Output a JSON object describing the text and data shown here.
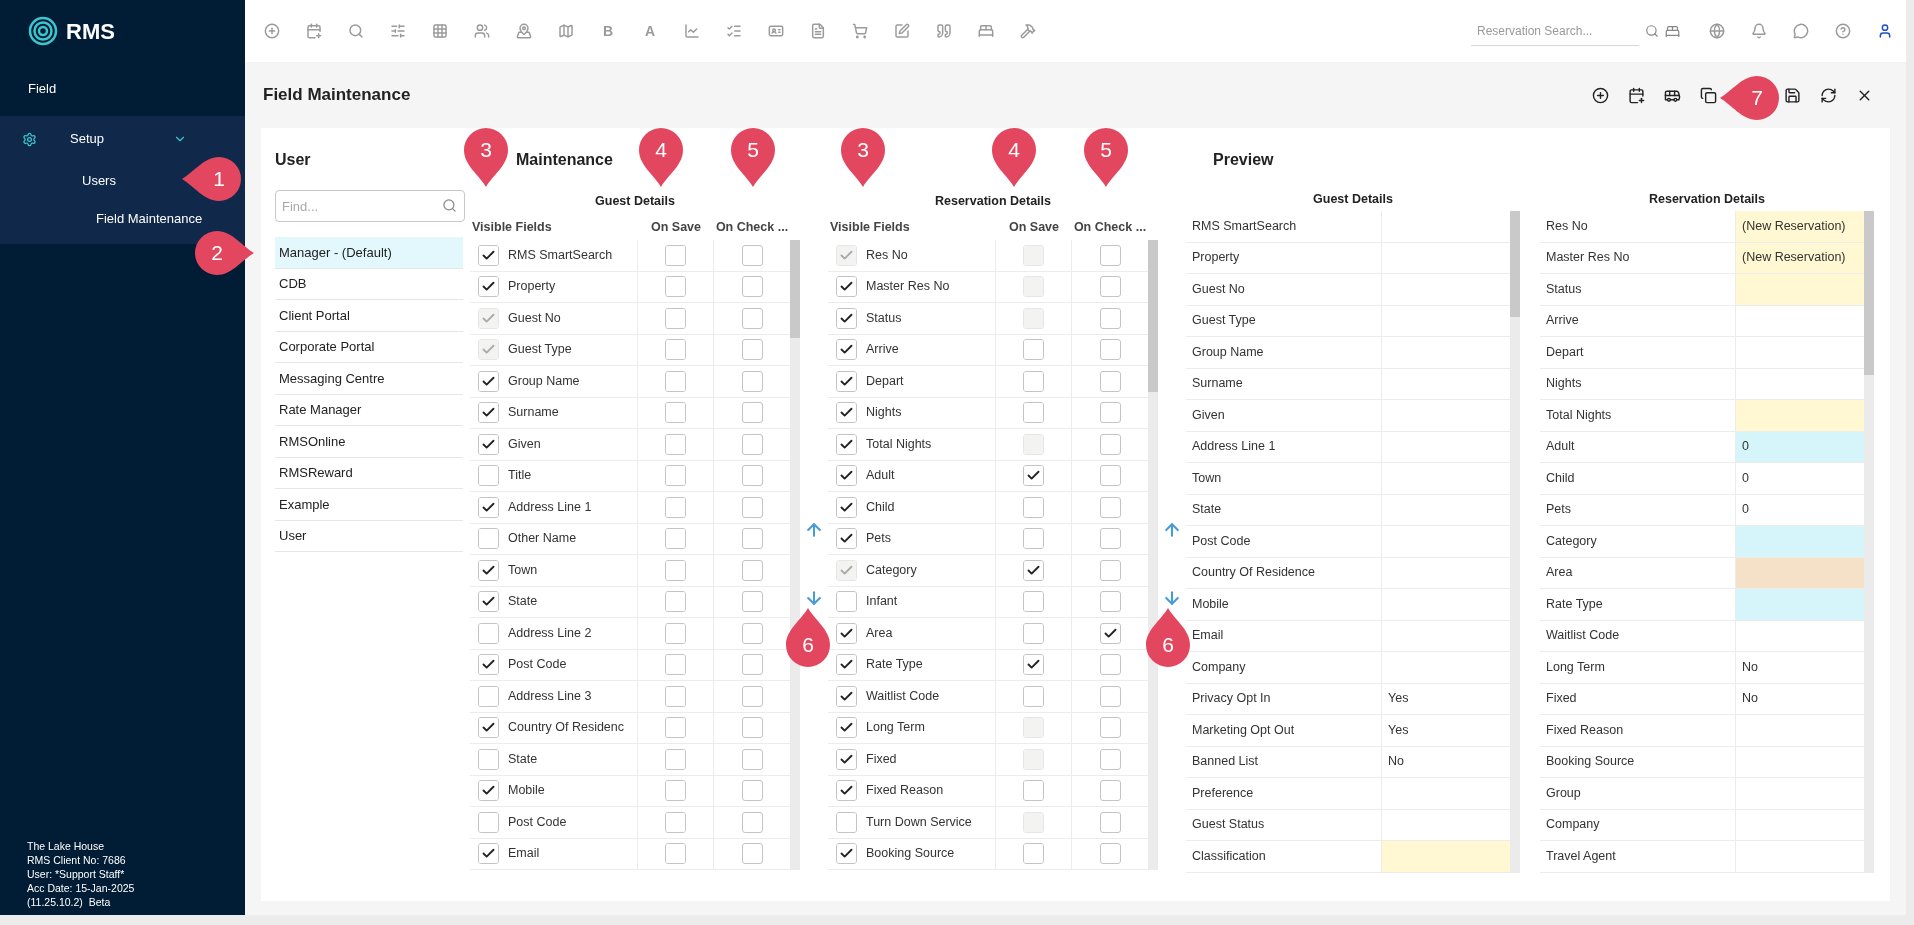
{
  "sidebar": {
    "logo": "RMS",
    "search": {
      "value": "Field"
    },
    "menu": [
      {
        "label": "Setup",
        "expanded": true,
        "children": [
          {
            "label": "Users"
          },
          {
            "label": "Field Maintenance"
          }
        ]
      }
    ],
    "footer": [
      "The Lake House",
      "RMS Client No: 7686",
      "User: *Support Staff*",
      "Acc Date: 15-Jan-2025",
      "(11.25.10.2)  Beta"
    ]
  },
  "topbar": {
    "letters": [
      "B",
      "A"
    ],
    "search": {
      "placeholder": "Reservation Search..."
    }
  },
  "page": {
    "title": "Field Maintenance"
  },
  "users": {
    "title": "User",
    "search": {
      "placeholder": "Find..."
    },
    "items": [
      {
        "label": "Manager - (Default)",
        "selected": true
      },
      {
        "label": "CDB",
        "selected": false
      },
      {
        "label": "Client Portal",
        "selected": false
      },
      {
        "label": "Corporate Portal",
        "selected": false
      },
      {
        "label": "Messaging Centre",
        "selected": false
      },
      {
        "label": "Rate Manager",
        "selected": false
      },
      {
        "label": "RMSOnline",
        "selected": false
      },
      {
        "label": "RMSReward",
        "selected": false
      },
      {
        "label": "Example",
        "selected": false
      },
      {
        "label": "User",
        "selected": false
      }
    ]
  },
  "maintenance": {
    "title": "Maintenance",
    "tables": [
      {
        "title": "Guest Details",
        "columns": [
          "Visible Fields",
          "On Save",
          "On Check ..."
        ],
        "rows": [
          {
            "field": "RMS SmartSearch",
            "visible": true,
            "locked": false,
            "on_save": false,
            "save_locked": false,
            "on_check": false
          },
          {
            "field": "Property",
            "visible": true,
            "locked": false,
            "on_save": false,
            "save_locked": false,
            "on_check": false
          },
          {
            "field": "Guest No",
            "visible": true,
            "locked": true,
            "on_save": false,
            "save_locked": false,
            "on_check": false
          },
          {
            "field": "Guest Type",
            "visible": true,
            "locked": true,
            "on_save": false,
            "save_locked": false,
            "on_check": false
          },
          {
            "field": "Group Name",
            "visible": true,
            "locked": false,
            "on_save": false,
            "save_locked": false,
            "on_check": false
          },
          {
            "field": "Surname",
            "visible": true,
            "locked": false,
            "on_save": false,
            "save_locked": false,
            "on_check": false
          },
          {
            "field": "Given",
            "visible": true,
            "locked": false,
            "on_save": false,
            "save_locked": false,
            "on_check": false
          },
          {
            "field": "Title",
            "visible": false,
            "locked": false,
            "on_save": false,
            "save_locked": false,
            "on_check": false
          },
          {
            "field": "Address Line 1",
            "visible": true,
            "locked": false,
            "on_save": false,
            "save_locked": false,
            "on_check": false
          },
          {
            "field": "Other Name",
            "visible": false,
            "locked": false,
            "on_save": false,
            "save_locked": false,
            "on_check": false
          },
          {
            "field": "Town",
            "visible": true,
            "locked": false,
            "on_save": false,
            "save_locked": false,
            "on_check": false
          },
          {
            "field": "State",
            "visible": true,
            "locked": false,
            "on_save": false,
            "save_locked": false,
            "on_check": false
          },
          {
            "field": "Address Line 2",
            "visible": false,
            "locked": false,
            "on_save": false,
            "save_locked": false,
            "on_check": false
          },
          {
            "field": "Post Code",
            "visible": true,
            "locked": false,
            "on_save": false,
            "save_locked": false,
            "on_check": false
          },
          {
            "field": "Address Line 3",
            "visible": false,
            "locked": false,
            "on_save": false,
            "save_locked": false,
            "on_check": false
          },
          {
            "field": "Country Of Residenc",
            "visible": true,
            "locked": false,
            "on_save": false,
            "save_locked": false,
            "on_check": false
          },
          {
            "field": "State",
            "visible": false,
            "locked": false,
            "on_save": false,
            "save_locked": false,
            "on_check": false
          },
          {
            "field": "Mobile",
            "visible": true,
            "locked": false,
            "on_save": false,
            "save_locked": false,
            "on_check": false
          },
          {
            "field": "Post Code",
            "visible": false,
            "locked": false,
            "on_save": false,
            "save_locked": false,
            "on_check": false
          },
          {
            "field": "Email",
            "visible": true,
            "locked": false,
            "on_save": false,
            "save_locked": false,
            "on_check": false
          }
        ]
      },
      {
        "title": "Reservation Details",
        "columns": [
          "Visible Fields",
          "On Save",
          "On Check ..."
        ],
        "rows": [
          {
            "field": "Res No",
            "visible": true,
            "locked": true,
            "on_save": false,
            "save_locked": true,
            "on_check": false
          },
          {
            "field": "Master Res No",
            "visible": true,
            "locked": false,
            "on_save": false,
            "save_locked": true,
            "on_check": false
          },
          {
            "field": "Status",
            "visible": true,
            "locked": false,
            "on_save": false,
            "save_locked": true,
            "on_check": false
          },
          {
            "field": "Arrive",
            "visible": true,
            "locked": false,
            "on_save": false,
            "save_locked": false,
            "on_check": false
          },
          {
            "field": "Depart",
            "visible": true,
            "locked": false,
            "on_save": false,
            "save_locked": false,
            "on_check": false
          },
          {
            "field": "Nights",
            "visible": true,
            "locked": false,
            "on_save": false,
            "save_locked": false,
            "on_check": false
          },
          {
            "field": "Total Nights",
            "visible": true,
            "locked": false,
            "on_save": false,
            "save_locked": true,
            "on_check": false
          },
          {
            "field": "Adult",
            "visible": true,
            "locked": false,
            "on_save": true,
            "save_locked": false,
            "on_check": false
          },
          {
            "field": "Child",
            "visible": true,
            "locked": false,
            "on_save": false,
            "save_locked": false,
            "on_check": false
          },
          {
            "field": "Pets",
            "visible": true,
            "locked": false,
            "on_save": false,
            "save_locked": false,
            "on_check": false
          },
          {
            "field": "Category",
            "visible": true,
            "locked": true,
            "on_save": true,
            "save_locked": false,
            "on_check": false
          },
          {
            "field": "Infant",
            "visible": false,
            "locked": false,
            "on_save": false,
            "save_locked": false,
            "on_check": false
          },
          {
            "field": "Area",
            "visible": true,
            "locked": false,
            "on_save": false,
            "save_locked": false,
            "on_check": true
          },
          {
            "field": "Rate Type",
            "visible": true,
            "locked": false,
            "on_save": true,
            "save_locked": false,
            "on_check": false
          },
          {
            "field": "Waitlist Code",
            "visible": true,
            "locked": false,
            "on_save": false,
            "save_locked": false,
            "on_check": false
          },
          {
            "field": "Long Term",
            "visible": true,
            "locked": false,
            "on_save": false,
            "save_locked": true,
            "on_check": false
          },
          {
            "field": "Fixed",
            "visible": true,
            "locked": false,
            "on_save": false,
            "save_locked": true,
            "on_check": false
          },
          {
            "field": "Fixed Reason",
            "visible": true,
            "locked": false,
            "on_save": false,
            "save_locked": false,
            "on_check": false
          },
          {
            "field": "Turn Down Service",
            "visible": false,
            "locked": false,
            "on_save": false,
            "save_locked": true,
            "on_check": false
          },
          {
            "field": "Booking Source",
            "visible": true,
            "locked": false,
            "on_save": false,
            "save_locked": false,
            "on_check": false
          }
        ]
      }
    ]
  },
  "preview": {
    "title": "Preview",
    "tables": [
      {
        "title": "Guest Details",
        "rows": [
          {
            "label": "RMS SmartSearch"
          },
          {
            "label": "Property"
          },
          {
            "label": "Guest No"
          },
          {
            "label": "Guest Type"
          },
          {
            "label": "Group Name"
          },
          {
            "label": "Surname"
          },
          {
            "label": "Given"
          },
          {
            "label": "Address Line 1"
          },
          {
            "label": "Town"
          },
          {
            "label": "State"
          },
          {
            "label": "Post Code"
          },
          {
            "label": "Country Of Residence"
          },
          {
            "label": "Mobile"
          },
          {
            "label": "Email"
          },
          {
            "label": "Company"
          },
          {
            "label": "Privacy Opt In",
            "value": "Yes"
          },
          {
            "label": "Marketing Opt Out",
            "value": "Yes"
          },
          {
            "label": "Banned List",
            "value": "No"
          },
          {
            "label": "Preference"
          },
          {
            "label": "Guest Status"
          },
          {
            "label": "Classification",
            "color": "#fff8d2"
          }
        ]
      },
      {
        "title": "Reservation Details",
        "rows": [
          {
            "label": "Res No",
            "value": "(New Reservation)",
            "color": "#fff8d2"
          },
          {
            "label": "Master Res No",
            "value": "(New Reservation)",
            "color": "#fff8d2"
          },
          {
            "label": "Status",
            "color": "#fff8d2"
          },
          {
            "label": "Arrive"
          },
          {
            "label": "Depart"
          },
          {
            "label": "Nights"
          },
          {
            "label": "Total Nights",
            "color": "#fff8d2"
          },
          {
            "label": "Adult",
            "value": "0",
            "color": "#d6f5fb"
          },
          {
            "label": "Child",
            "value": "0"
          },
          {
            "label": "Pets",
            "value": "0"
          },
          {
            "label": "Category",
            "color": "#d6f5fb"
          },
          {
            "label": "Area",
            "color": "#f5e1c8"
          },
          {
            "label": "Rate Type",
            "color": "#d6f5fb"
          },
          {
            "label": "Waitlist Code"
          },
          {
            "label": "Long Term",
            "value": "No"
          },
          {
            "label": "Fixed",
            "value": "No"
          },
          {
            "label": "Fixed Reason"
          },
          {
            "label": "Booking Source"
          },
          {
            "label": "Group"
          },
          {
            "label": "Company"
          },
          {
            "label": "Travel Agent"
          }
        ]
      }
    ]
  },
  "callouts": [
    {
      "number": "1"
    },
    {
      "number": "2"
    },
    {
      "number": "3"
    },
    {
      "number": "4"
    },
    {
      "number": "5"
    },
    {
      "number": "3"
    },
    {
      "number": "4"
    },
    {
      "number": "5"
    },
    {
      "number": "6"
    },
    {
      "number": "6"
    },
    {
      "number": "7"
    }
  ]
}
